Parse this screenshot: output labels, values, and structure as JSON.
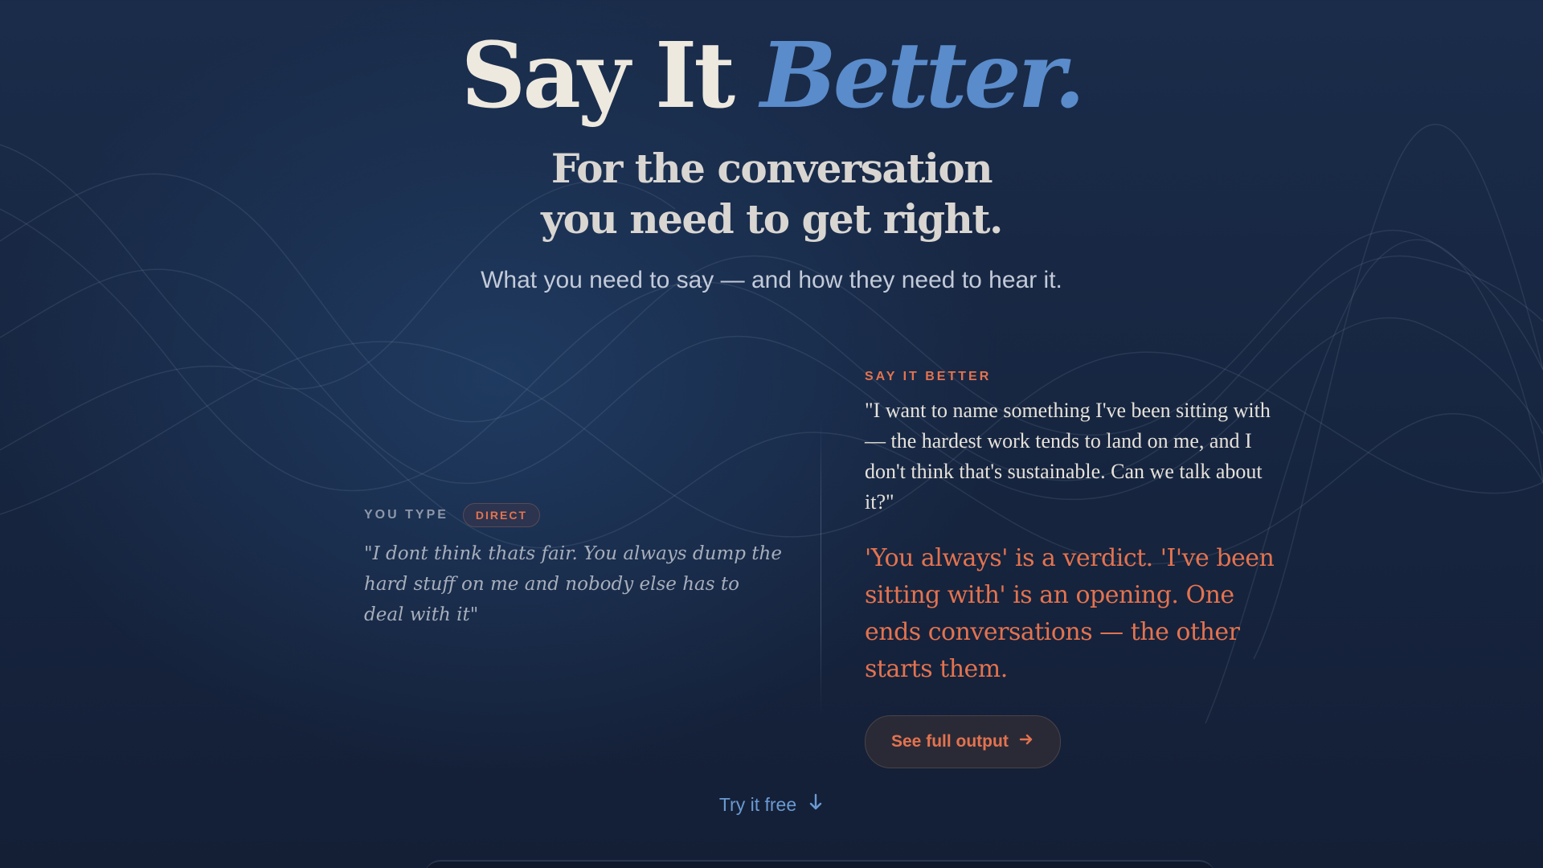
{
  "hero": {
    "title_main": "Say It ",
    "title_accent": "Better.",
    "subhead_line1": "For the conversation",
    "subhead_line2": "you need to get right.",
    "tagline": "What you need to say — and how they need to hear it."
  },
  "example": {
    "input_label": "YOU TYPE",
    "tone_badge": "DIRECT",
    "input_text": "\"I dont think thats fair. You always dump the hard stuff on me and nobody else has to deal with it\"",
    "output_label": "SAY IT BETTER",
    "output_text": "\"I want to name something I've been sitting with — the hardest work tends to land on me, and I don't think that's sustainable. Can we talk about it?\"",
    "insight_text": "'You always' is a verdict. 'I've been sitting with' is an opening. One ends conversations — the other starts them.",
    "cta_label": "See full output"
  },
  "footer": {
    "try_label": "Try it free"
  },
  "icons": {
    "cta_icon": "arrow-right-icon",
    "try_icon": "arrow-down-icon"
  },
  "colors": {
    "accent_orange": "#e3734f",
    "accent_blue": "#5a8bca",
    "background": "#172641"
  }
}
